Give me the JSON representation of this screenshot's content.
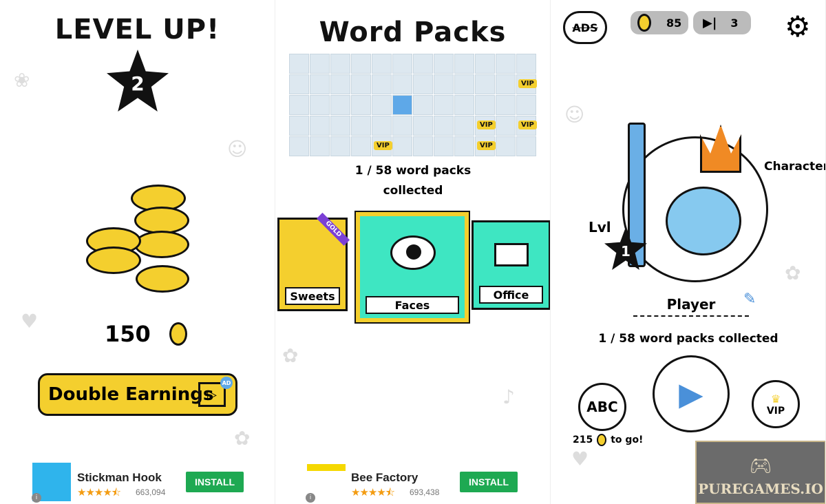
{
  "left": {
    "title": "LEVEL UP!",
    "level": "2",
    "coins": "150",
    "double_label": "Double Earnings",
    "ad_badge": "AD",
    "ad": {
      "title": "Stickman Hook",
      "rating": 4.5,
      "count": "663,094",
      "install": "INSTALL",
      "info": "i"
    }
  },
  "middle": {
    "title": "Word Packs",
    "vip_label": "VIP",
    "collected_line1": "1 / 58 word packs",
    "collected_line2": "collected",
    "packs": [
      {
        "label": "Sweets",
        "badge": "GOLD"
      },
      {
        "label": "Faces"
      },
      {
        "label": "Office"
      }
    ],
    "ad": {
      "title": "Bee Factory",
      "rating": 4.5,
      "count": "693,438",
      "install": "INSTALL",
      "info": "i"
    }
  },
  "right": {
    "no_ads": "ADS",
    "coins": "85",
    "skips": "3",
    "character_label": "Character",
    "lvl_label": "Lvl",
    "lvl": "1",
    "player_name": "Player",
    "collected": "1 / 58 word packs collected",
    "abc": "ABC",
    "cost": "215",
    "to_go": "to go!",
    "vip": "VIP",
    "watermark": "PUREGAMES.IO"
  },
  "colors": {
    "yellow": "#f4cf2e",
    "teal": "#3ee6c2",
    "install_green": "#1ea952",
    "blue": "#5ea8e8"
  }
}
